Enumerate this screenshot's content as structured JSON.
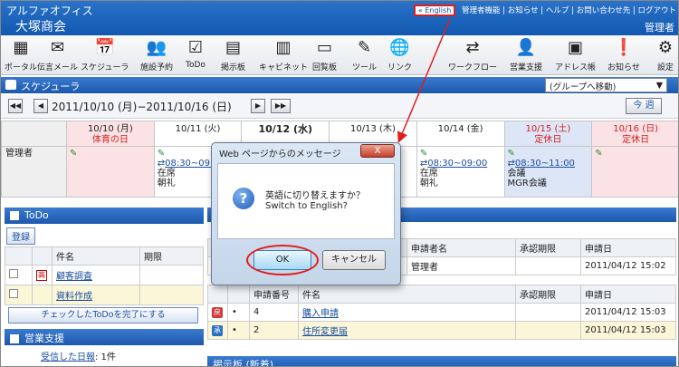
{
  "header": {
    "app_name": "アルファオフィス",
    "company": "大塚商会",
    "english_link": "« English",
    "links": [
      "管理者機能",
      "お知らせ",
      "ヘルプ",
      "お問い合わせ先",
      "ログアウト"
    ],
    "user": "管理者"
  },
  "toolbar": [
    {
      "label": "ポータル",
      "icon": "portal-icon"
    },
    {
      "label": "伝言メール",
      "icon": "memo-mail-icon"
    },
    {
      "label": "スケジューラ",
      "icon": "scheduler-icon"
    },
    {
      "label": "施設予約",
      "icon": "facility-icon"
    },
    {
      "label": "ToDo",
      "icon": "todo-icon"
    },
    {
      "label": "掲示板",
      "icon": "bulletin-icon"
    },
    {
      "label": "キャビネット",
      "icon": "cabinet-icon"
    },
    {
      "label": "回覧板",
      "icon": "circular-icon"
    },
    {
      "label": "ツール",
      "icon": "tool-icon"
    },
    {
      "label": "リンク",
      "icon": "link-icon"
    },
    {
      "label": "ワークフロー",
      "icon": "workflow-icon"
    },
    {
      "label": "営業支援",
      "icon": "sales-icon"
    },
    {
      "label": "アドレス帳",
      "icon": "address-book-icon"
    },
    {
      "label": "お知らせ",
      "icon": "notice-icon"
    },
    {
      "label": "設定",
      "icon": "settings-icon"
    }
  ],
  "scheduler": {
    "title": "スケジューラ",
    "group_select": "(グループへ移動)",
    "range": "2011/10/10 (月)−2011/10/16 (日)",
    "today_button": "今 週",
    "row_label": "管理者",
    "days": [
      {
        "date": "10/10 (月)",
        "note": "体育の日",
        "style": "pink",
        "entry": {
          "time": "",
          "status": "",
          "title": ""
        }
      },
      {
        "date": "10/11 (火)",
        "note": "",
        "style": "",
        "entry": {
          "time": "08:30~09:00",
          "status": "在席",
          "title": "朝礼"
        }
      },
      {
        "date": "10/12 (水)",
        "note": "",
        "style": "bold",
        "entry": {
          "time": "",
          "status": "",
          "title": ""
        }
      },
      {
        "date": "10/13 (木)",
        "note": "",
        "style": "",
        "entry": {
          "time": "",
          "status": "",
          "title": ""
        }
      },
      {
        "date": "10/14 (金)",
        "note": "",
        "style": "",
        "entry": {
          "time": "08:30~09:00",
          "status": "在席",
          "title": "朝礼"
        }
      },
      {
        "date": "10/15 (土)",
        "note": "定休日",
        "style": "blue",
        "entry": {
          "time": "08:30~11:00",
          "status": "会議",
          "title": "MGR会議"
        }
      },
      {
        "date": "10/16 (日)",
        "note": "定休日",
        "style": "pink",
        "entry": {
          "time": "",
          "status": "",
          "title": ""
        }
      }
    ]
  },
  "todo": {
    "title": "ToDo",
    "register_button": "登録",
    "col_name": "件名",
    "col_deadline": "期限",
    "items": [
      {
        "priority": "高",
        "name": "顧客調査"
      },
      {
        "priority": "",
        "name": "資料作成"
      }
    ],
    "complete_button": "チェックしたToDoを完了にする"
  },
  "sales": {
    "title": "営業支援",
    "received_link": "受信した日報",
    "received_count": ": 1件"
  },
  "workflow": {
    "top_headers": [
      "申請者名",
      "承認期限",
      "申請日"
    ],
    "top_rows": [
      {
        "applicant": "管理者",
        "deadline": "",
        "date": "2011/04/12 15:02"
      }
    ],
    "headers": [
      "申請番号",
      "件名",
      "承認期限",
      "申請日"
    ],
    "rows": [
      {
        "stamp": "戻",
        "stamp_color": "#d33b3b",
        "number": "4",
        "title": "購入申請",
        "date": "2011/04/12 15:03"
      },
      {
        "stamp": "承",
        "stamp_color": "#2a6dc2",
        "number": "2",
        "title": "住所変更届",
        "date": "2011/04/12 15:03"
      }
    ]
  },
  "bulletin_title": "掲示板 (新着)",
  "dialog": {
    "title": "Web ページからのメッセージ",
    "close": "X",
    "message_jp": "英語に切り替えますか？",
    "message_en": "Switch to English?",
    "ok": "OK",
    "cancel": "キャンセル"
  },
  "colors": {
    "header_blue": "#1d59ad",
    "highlight_red": "#e01e1e",
    "holiday_red": "#d61d1d"
  }
}
